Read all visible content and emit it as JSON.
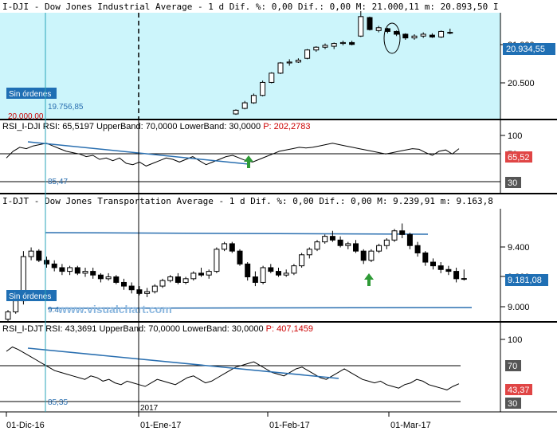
{
  "panels": {
    "dji": {
      "header": "I-DJI - Dow Jones Industrial Average -  1 d Dif. %: 0,00 Dif.: 0,00 M: 21.000,11 m: 20.893,50 I",
      "price_ticks": [
        "21.000",
        "20.500"
      ],
      "last_badge": "20.934,55",
      "orders_badge": "Sin órdenes",
      "marker_value": "19.756,85",
      "marker_value_low": "20.000,00",
      "colors": {
        "background": "#ccf5fb",
        "badge": "#1f6fb4",
        "line": "#2a6fb0"
      }
    },
    "rsi_dji": {
      "header_name": "RSI_I-DJI",
      "header_rest": " RSI: 65,5197  UpperBand: 70,0000  LowerBand: 30,0000 ",
      "header_p": "P: 202,2783",
      "ticks": [
        "100",
        "70",
        "30"
      ],
      "value_badge": "65,52",
      "marker_value": "85,47"
    },
    "djt": {
      "header": "I-DJT - Dow Jones Transportation Average -  1 d Dif. %: 0,00 Dif.: 0,00 M: 9.239,91 m: 9.163,8",
      "price_ticks": [
        "9.400",
        "9.200",
        "9.000"
      ],
      "last_badge": "9.181,08",
      "orders_badge": "Sin órdenes",
      "marker_value": "9.4",
      "watermark": "www.visualchart.com"
    },
    "rsi_djt": {
      "header_name": "RSI_I-DJT",
      "header_rest": " RSI: 43,3691  UpperBand: 70,0000  LowerBand: 30,0000 ",
      "header_p": "P: 407,1459",
      "ticks": [
        "100",
        "70",
        "30"
      ],
      "value_badge": "43,37",
      "marker_value": "85,35",
      "year_label": "2017"
    }
  },
  "x_axis": {
    "labels": [
      "01-Dic-16",
      "01-Ene-17",
      "01-Feb-17",
      "01-Mar-17"
    ]
  },
  "chart_data": [
    {
      "type": "candlestick",
      "title": "I-DJI - Dow Jones Industrial Average",
      "ylim": [
        20000,
        21100
      ],
      "y_ticks": [
        21000,
        20500
      ],
      "x": [
        "2017-02-08",
        "2017-02-09",
        "2017-02-10",
        "2017-02-13",
        "2017-02-14",
        "2017-02-15",
        "2017-02-16",
        "2017-02-17",
        "2017-02-21",
        "2017-02-22",
        "2017-02-23",
        "2017-02-24",
        "2017-02-27",
        "2017-02-28",
        "2017-03-01",
        "2017-03-02",
        "2017-03-03",
        "2017-03-06",
        "2017-03-07",
        "2017-03-08",
        "2017-03-09",
        "2017-03-10",
        "2017-03-13",
        "2017-03-14",
        "2017-03-15"
      ],
      "ohlc": [
        [
          20060,
          20110,
          20050,
          20100
        ],
        [
          20120,
          20200,
          20110,
          20180
        ],
        [
          20180,
          20280,
          20170,
          20260
        ],
        [
          20260,
          20420,
          20250,
          20400
        ],
        [
          20400,
          20510,
          20390,
          20500
        ],
        [
          20500,
          20620,
          20490,
          20610
        ],
        [
          20610,
          20650,
          20580,
          20620
        ],
        [
          20620,
          20660,
          20610,
          20640
        ],
        [
          20660,
          20760,
          20650,
          20750
        ],
        [
          20750,
          20790,
          20730,
          20780
        ],
        [
          20780,
          20820,
          20760,
          20800
        ],
        [
          20790,
          20830,
          20760,
          20820
        ],
        [
          20820,
          20850,
          20800,
          20830
        ],
        [
          20830,
          20850,
          20800,
          20810
        ],
        [
          20900,
          21170,
          20890,
          21110
        ],
        [
          21100,
          21110,
          20960,
          20970
        ],
        [
          20960,
          21010,
          20940,
          20990
        ],
        [
          20980,
          20990,
          20930,
          20950
        ],
        [
          20950,
          20960,
          20900,
          20920
        ],
        [
          20920,
          20930,
          20860,
          20880
        ],
        [
          20880,
          20920,
          20860,
          20900
        ],
        [
          20900,
          20940,
          20880,
          20920
        ],
        [
          20910,
          20930,
          20880,
          20890
        ],
        [
          20890,
          20960,
          20880,
          20950
        ],
        [
          20940,
          20980,
          20920,
          20934.55
        ]
      ],
      "last": 20934.55
    },
    {
      "type": "line",
      "title": "RSI_I-DJI",
      "ylim": [
        0,
        100
      ],
      "bands": [
        70,
        30
      ],
      "values": [
        52,
        62,
        68,
        66,
        70,
        72,
        74,
        70,
        66,
        62,
        60,
        58,
        54,
        56,
        50,
        52,
        48,
        52,
        44,
        42,
        46,
        40,
        44,
        48,
        52,
        50,
        46,
        50,
        54,
        48,
        42,
        46,
        50,
        54,
        56,
        52,
        48,
        46,
        50,
        54,
        58,
        62,
        64,
        66,
        68,
        67,
        68,
        70,
        72,
        74,
        72,
        70,
        68,
        66,
        64,
        62,
        60,
        58,
        60,
        62,
        64,
        66,
        65,
        60,
        56,
        62,
        64,
        58,
        66
      ],
      "last": 65.52
    },
    {
      "type": "candlestick",
      "title": "I-DJT - Dow Jones Transportation Average",
      "ylim": [
        8950,
        9560
      ],
      "y_ticks": [
        9400,
        9200,
        9000
      ],
      "ohlc": [
        [
          8960,
          9010,
          8950,
          9000
        ],
        [
          9000,
          9080,
          8990,
          9060
        ],
        [
          9060,
          9330,
          9040,
          9300
        ],
        [
          9300,
          9350,
          9280,
          9330
        ],
        [
          9330,
          9340,
          9270,
          9280
        ],
        [
          9280,
          9300,
          9240,
          9260
        ],
        [
          9260,
          9280,
          9220,
          9240
        ],
        [
          9240,
          9260,
          9200,
          9220
        ],
        [
          9220,
          9250,
          9200,
          9240
        ],
        [
          9240,
          9250,
          9200,
          9210
        ],
        [
          9210,
          9240,
          9190,
          9220
        ],
        [
          9220,
          9240,
          9180,
          9200
        ],
        [
          9200,
          9210,
          9160,
          9180
        ],
        [
          9180,
          9210,
          9170,
          9190
        ],
        [
          9190,
          9200,
          9150,
          9160
        ],
        [
          9160,
          9180,
          9120,
          9140
        ],
        [
          9140,
          9160,
          9100,
          9120
        ],
        [
          9120,
          9140,
          9090,
          9100
        ],
        [
          9100,
          9130,
          9080,
          9110
        ],
        [
          9110,
          9150,
          9100,
          9140
        ],
        [
          9140,
          9180,
          9130,
          9170
        ],
        [
          9170,
          9200,
          9160,
          9190
        ],
        [
          9190,
          9210,
          9150,
          9160
        ],
        [
          9160,
          9190,
          9150,
          9180
        ],
        [
          9180,
          9220,
          9170,
          9210
        ],
        [
          9210,
          9240,
          9190,
          9200
        ],
        [
          9200,
          9230,
          9180,
          9220
        ],
        [
          9220,
          9350,
          9210,
          9340
        ],
        [
          9340,
          9380,
          9330,
          9370
        ],
        [
          9370,
          9380,
          9320,
          9330
        ],
        [
          9330,
          9340,
          9250,
          9260
        ],
        [
          9260,
          9270,
          9170,
          9190
        ],
        [
          9190,
          9220,
          9140,
          9160
        ],
        [
          9160,
          9250,
          9150,
          9240
        ],
        [
          9240,
          9260,
          9210,
          9220
        ],
        [
          9220,
          9240,
          9190,
          9200
        ],
        [
          9200,
          9230,
          9190,
          9210
        ],
        [
          9210,
          9260,
          9200,
          9250
        ],
        [
          9250,
          9320,
          9240,
          9310
        ],
        [
          9310,
          9350,
          9290,
          9340
        ],
        [
          9340,
          9390,
          9330,
          9380
        ],
        [
          9380,
          9420,
          9370,
          9410
        ],
        [
          9410,
          9440,
          9380,
          9390
        ],
        [
          9390,
          9410,
          9350,
          9360
        ],
        [
          9360,
          9380,
          9340,
          9370
        ],
        [
          9370,
          9390,
          9320,
          9330
        ],
        [
          9330,
          9340,
          9260,
          9280
        ],
        [
          9280,
          9340,
          9270,
          9330
        ],
        [
          9330,
          9370,
          9320,
          9360
        ],
        [
          9360,
          9400,
          9340,
          9390
        ],
        [
          9390,
          9450,
          9380,
          9440
        ],
        [
          9440,
          9480,
          9400,
          9420
        ],
        [
          9420,
          9430,
          9340,
          9360
        ],
        [
          9360,
          9380,
          9300,
          9320
        ],
        [
          9320,
          9330,
          9250,
          9270
        ],
        [
          9270,
          9290,
          9230,
          9250
        ],
        [
          9250,
          9270,
          9210,
          9230
        ],
        [
          9230,
          9250,
          9200,
          9220
        ],
        [
          9220,
          9240,
          9160,
          9180
        ],
        [
          9180,
          9230,
          9170,
          9181.08
        ]
      ],
      "last": 9181.08
    },
    {
      "type": "line",
      "title": "RSI_I-DJT",
      "ylim": [
        0,
        100
      ],
      "bands": [
        70,
        30
      ],
      "values": [
        80,
        85,
        82,
        78,
        74,
        70,
        66,
        62,
        58,
        56,
        54,
        52,
        50,
        48,
        52,
        50,
        46,
        48,
        44,
        42,
        46,
        44,
        42,
        40,
        44,
        48,
        46,
        44,
        42,
        46,
        50,
        52,
        48,
        44,
        46,
        50,
        54,
        58,
        62,
        64,
        66,
        68,
        64,
        60,
        56,
        54,
        52,
        56,
        60,
        62,
        58,
        54,
        50,
        48,
        52,
        56,
        60,
        56,
        52,
        48,
        46,
        44,
        46,
        42,
        40,
        38,
        42,
        44,
        48,
        46,
        42,
        40,
        38,
        36,
        40,
        43
      ]
    }
  ]
}
